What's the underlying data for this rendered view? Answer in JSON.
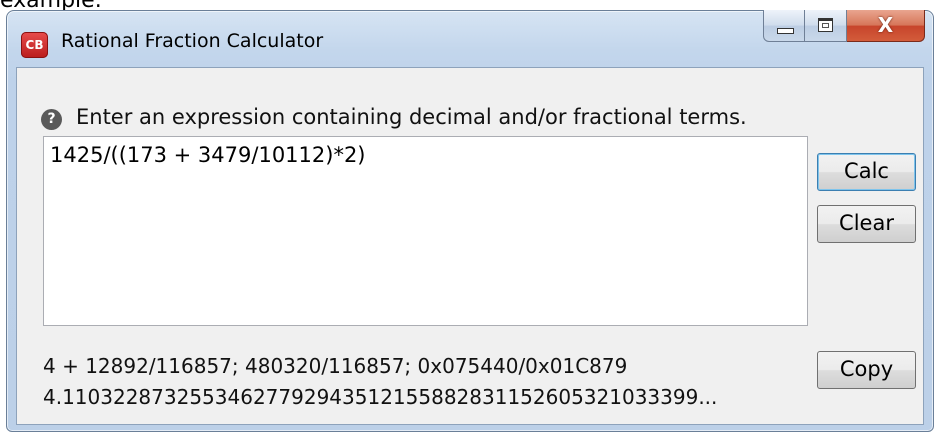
{
  "page": {
    "caption_text": "example."
  },
  "window": {
    "icon_text": "CB",
    "title": "Rational Fraction Calculator",
    "controls": {
      "close_glyph": "X"
    }
  },
  "main": {
    "help_glyph": "?",
    "prompt": "Enter an expression containing decimal and/or fractional terms.",
    "expression_value": "1425/((173 + 3479/10112)*2)",
    "buttons": {
      "calc": "Calc",
      "clear": "Clear",
      "copy": "Copy"
    },
    "result_line1": "4 + 12892/116857; 480320/116857; 0x075440/0x01C879",
    "result_line2": "4.11032287325534627792943512155882831152605321033399..."
  }
}
